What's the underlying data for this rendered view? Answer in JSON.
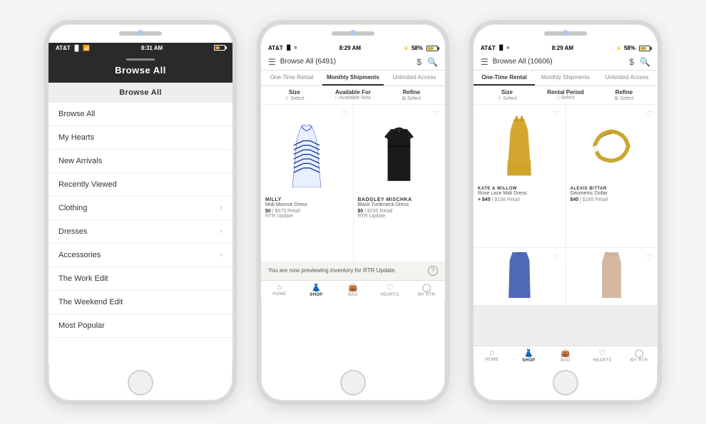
{
  "background": "#f5f5f5",
  "phones": [
    {
      "id": "phone1",
      "status": {
        "carrier": "AT&T",
        "time": "8:31 AM",
        "battery": 64,
        "battery_color": "orange"
      },
      "header_title": "Browse All",
      "menu_section": "Browse All",
      "menu_items": [
        {
          "label": "Browse All",
          "arrow": false
        },
        {
          "label": "My Hearts",
          "arrow": false
        },
        {
          "label": "New Arrivals",
          "arrow": false
        },
        {
          "label": "Recently Viewed",
          "arrow": false
        },
        {
          "label": "Clothing",
          "arrow": true
        },
        {
          "label": "Dresses",
          "arrow": true
        },
        {
          "label": "Accessories",
          "arrow": true
        },
        {
          "label": "The Work Edit",
          "arrow": false
        },
        {
          "label": "The Weekend Edit",
          "arrow": false
        },
        {
          "label": "Most Popular",
          "arrow": false
        }
      ]
    },
    {
      "id": "phone2",
      "status": {
        "carrier": "AT&T",
        "time": "8:29 AM",
        "battery": 58,
        "battery_color": "yellow"
      },
      "header_title": "Browse All (6491)",
      "tabs": [
        {
          "label": "One-Time Rental",
          "active": false
        },
        {
          "label": "Monthly Shipments",
          "active": true
        },
        {
          "label": "Unlimited Access",
          "active": false
        }
      ],
      "filters": [
        {
          "label": "Size",
          "sub": "Select"
        },
        {
          "label": "Available For",
          "sub": "Available Now"
        },
        {
          "label": "Refine",
          "sub": "Select"
        }
      ],
      "products": [
        {
          "brand": "MILLY",
          "name": "Midi Monroe Dress",
          "rental": "$0",
          "retail": "$675 Retail",
          "update": "RTR Update",
          "type": "dress_blue"
        },
        {
          "brand": "BADGLEY MISCHKA",
          "name": "Black Turtleneck Dress",
          "rental": "$0",
          "retail": "$295 Retail",
          "update": "RTR Update",
          "type": "dress_black"
        }
      ],
      "preview_text": "You are now previewing inventory for RTR Update.",
      "nav": [
        {
          "icon": "🏠",
          "label": "HOME",
          "active": false
        },
        {
          "icon": "👗",
          "label": "SHOP",
          "active": true
        },
        {
          "icon": "👜",
          "label": "BAG",
          "active": false
        },
        {
          "icon": "♡",
          "label": "HEARTS",
          "active": false
        },
        {
          "icon": "◯",
          "label": "MY RTR",
          "active": false
        }
      ]
    },
    {
      "id": "phone3",
      "status": {
        "carrier": "AT&T",
        "time": "8:29 AM",
        "battery": 58,
        "battery_color": "yellow"
      },
      "header_title": "Browse All (10606)",
      "tabs": [
        {
          "label": "One-Time Rental",
          "active": true
        },
        {
          "label": "Monthly Shipments",
          "active": false
        },
        {
          "label": "Unlimited Access",
          "active": false
        }
      ],
      "filters": [
        {
          "label": "Size",
          "sub": "Select"
        },
        {
          "label": "Rental Period",
          "sub": "Select"
        },
        {
          "label": "Refine",
          "sub": "Select"
        }
      ],
      "products": [
        {
          "brand": "KATE & WILLOW",
          "name": "Rose Lace Midi Dress",
          "rental": "+ $45",
          "retail": "$158 Retail",
          "type": "dress_gold"
        },
        {
          "brand": "ALEXIS BITTAR",
          "name": "Geometric Dollar",
          "rental": "$40",
          "retail": "$285 Retail",
          "type": "bracelet"
        },
        {
          "brand": "",
          "name": "",
          "rental": "",
          "retail": "",
          "type": "dress_blue2"
        },
        {
          "brand": "",
          "name": "",
          "rental": "",
          "retail": "",
          "type": "cami_nude"
        }
      ],
      "nav": [
        {
          "icon": "🏠",
          "label": "HOME",
          "active": false
        },
        {
          "icon": "👗",
          "label": "SHOP",
          "active": true
        },
        {
          "icon": "👜",
          "label": "BAG",
          "active": false
        },
        {
          "icon": "♡",
          "label": "HEARTS",
          "active": false
        },
        {
          "icon": "◯",
          "label": "MY RTR",
          "active": false
        }
      ]
    }
  ]
}
